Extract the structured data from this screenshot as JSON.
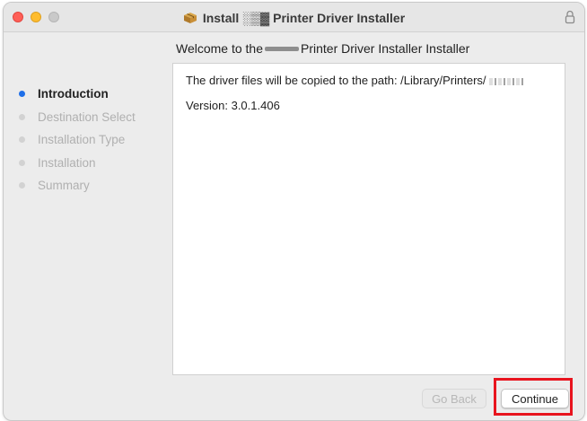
{
  "window": {
    "title": "Install ░▒▓ Printer Driver Installer",
    "icons": {
      "package": "package-icon",
      "lock": "lock-icon"
    },
    "traffic_lights": [
      "close",
      "minimize",
      "zoom"
    ]
  },
  "heading": {
    "prefix": "Welcome to the",
    "suffix": "Printer Driver Installer Installer"
  },
  "sidebar": {
    "steps": [
      {
        "label": "Introduction",
        "active": true
      },
      {
        "label": "Destination Select",
        "active": false
      },
      {
        "label": "Installation Type",
        "active": false
      },
      {
        "label": "Installation",
        "active": false
      },
      {
        "label": "Summary",
        "active": false
      }
    ]
  },
  "content": {
    "path_line": "The driver files will be copied to the path: /Library/Printers/",
    "version_line": "Version: 3.0.1.406"
  },
  "buttons": {
    "back_label": "Go Back",
    "continue_label": "Continue"
  },
  "colors": {
    "accent": "#1f6fe8",
    "highlight": "#e8141e",
    "close": "#fe5f57",
    "minimize": "#febc2e",
    "zoom_disabled": "#c9c9c9"
  }
}
